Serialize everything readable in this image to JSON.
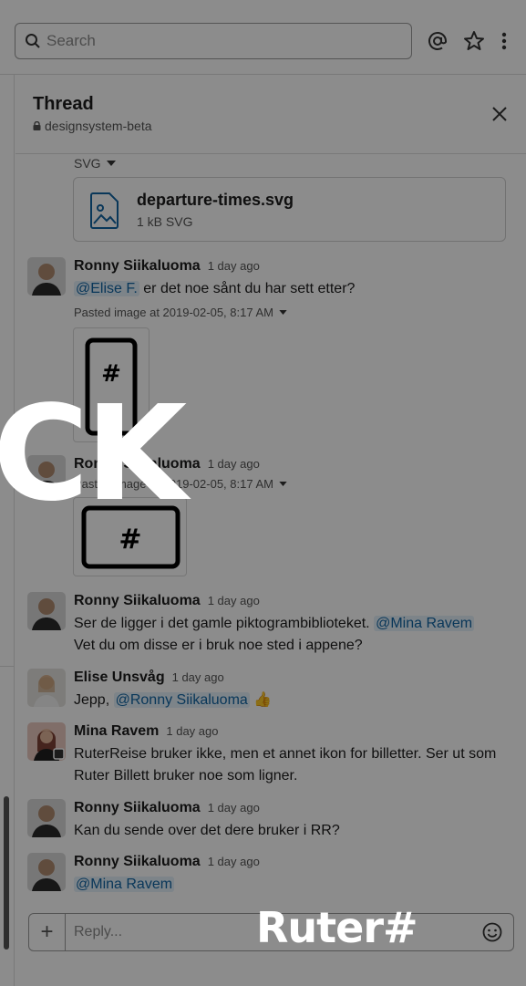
{
  "topbar": {
    "search_placeholder": "Search"
  },
  "thread": {
    "title": "Thread",
    "channel": "designsystem-beta",
    "file_type_label": "SVG",
    "file": {
      "name": "departure-times.svg",
      "meta": "1 kB SVG"
    }
  },
  "messages": [
    {
      "author": "Ronny Siikaluoma",
      "time": "1 day ago",
      "mention": "@Elise F.",
      "text": "er det noe sånt du har sett etter?",
      "pasted": "Pasted image at 2019-02-05, 8:17 AM"
    },
    {
      "author": "Ronny Siikaluoma",
      "time": "1 day ago",
      "pasted": "Pasted image at 2019-02-05, 8:17 AM"
    },
    {
      "author": "Ronny Siikaluoma",
      "time": "1 day ago",
      "text": "Ser de ligger i det gamle piktogrambiblioteket.",
      "mention": "@Mina Ravem",
      "text2": "Vet du om disse er i bruk noe sted i appene?"
    },
    {
      "author": "Elise Unsvåg",
      "time": "1 day ago",
      "text": "Jepp,",
      "mention": "@Ronny Siikaluoma",
      "emoji": "👍"
    },
    {
      "author": "Mina Ravem",
      "time": "1 day ago",
      "text": "RuterReise bruker ikke, men et annet ikon for billetter. Ser ut som Ruter Billett bruker noe som ligner."
    },
    {
      "author": "Ronny Siikaluoma",
      "time": "1 day ago",
      "text": "Kan du sende over det dere bruker i RR?"
    },
    {
      "author": "Ronny Siikaluoma",
      "time": "1 day ago",
      "mention": "@Mina Ravem"
    }
  ],
  "composer": {
    "placeholder": "Reply..."
  },
  "overlay": {
    "big_text": "CK",
    "brand": "Ruter#"
  },
  "colors": {
    "mention": "#1264a3",
    "mention_bg": "#e3f0fa",
    "overlay": "#000000"
  }
}
